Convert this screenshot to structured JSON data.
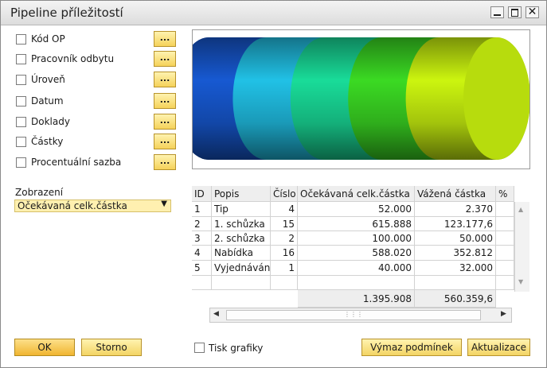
{
  "window": {
    "title": "Pipeline příležitostí",
    "min_glyph": "",
    "max_glyph": "",
    "close_glyph": "✕"
  },
  "filters": [
    {
      "label": "Kód OP",
      "checked": false,
      "button": "..."
    },
    {
      "label": "Pracovník odbytu",
      "checked": false,
      "button": "..."
    },
    {
      "label": "Úroveň",
      "checked": false,
      "button": "..."
    },
    {
      "label": "Datum",
      "checked": false,
      "button": "..."
    },
    {
      "label": "Doklady",
      "checked": false,
      "button": "..."
    },
    {
      "label": "Částky",
      "checked": false,
      "button": "..."
    },
    {
      "label": "Procentuální sazba",
      "checked": false,
      "button": "..."
    }
  ],
  "view": {
    "label": "Zobrazení",
    "selected": "Očekávaná celk.částka",
    "arrow": "▼"
  },
  "chart_data": {
    "type": "pipeline-cylinder",
    "categories": [
      "Tip",
      "1. schůzka",
      "2. schůzka",
      "Nabídka",
      "Vyjednávání"
    ],
    "values": [
      52000,
      615888,
      100000,
      588020,
      40000
    ],
    "colors": [
      "#1247a8",
      "#1a9ab8",
      "#14b07a",
      "#2fae1c",
      "#a3c40c"
    ]
  },
  "table": {
    "headers": [
      "ID",
      "Popis",
      "Číslo",
      "Očekávaná celk.částka",
      "Vážená částka",
      "%"
    ],
    "rows": [
      [
        "1",
        "Tip",
        "4",
        "52.000",
        "2.370",
        ""
      ],
      [
        "2",
        "1. schůzka",
        "15",
        "615.888",
        "123.177,6",
        ""
      ],
      [
        "3",
        "2. schůzka",
        "2",
        "100.000",
        "50.000",
        ""
      ],
      [
        "4",
        "Nabídka",
        "16",
        "588.020",
        "352.812",
        ""
      ],
      [
        "5",
        "Vyjednávání",
        "1",
        "40.000",
        "32.000",
        ""
      ]
    ],
    "totals": {
      "expected": "1.395.908",
      "weighted": "560.359,6"
    }
  },
  "scroll": {
    "up": "▲",
    "down": "▼",
    "left": "◀",
    "right": "▶",
    "grip": "⋮⋮⋮"
  },
  "footer": {
    "ok_label": "OK",
    "cancel_label": "Storno",
    "print_chart_label": "Tisk grafiky",
    "print_checked": false,
    "criteria_label": "Výmaz podmínek",
    "refresh_label": "Aktualizace"
  }
}
